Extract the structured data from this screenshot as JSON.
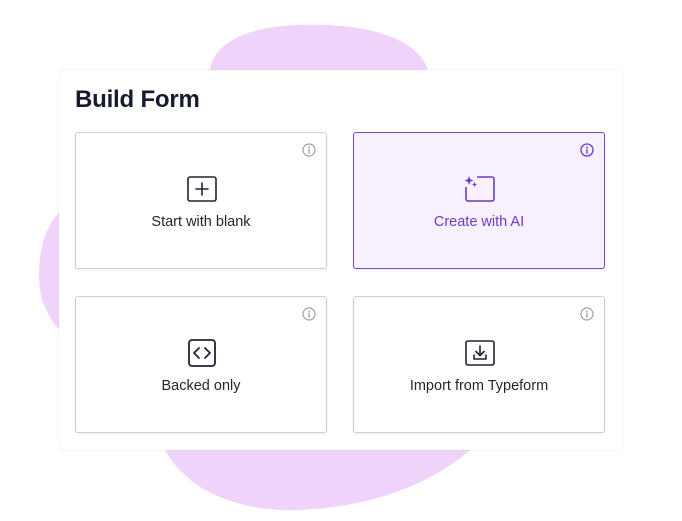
{
  "colors": {
    "blob": "#efd3fb",
    "accent": "#7c44d6",
    "selected_bg": "#f6f0ff",
    "text": "#1f2433"
  },
  "page": {
    "title": "Build Form"
  },
  "options": [
    {
      "label": "Start with blank",
      "icon": "plus-square-icon",
      "selected": false
    },
    {
      "label": "Create with AI",
      "icon": "sparkle-window-icon",
      "selected": true
    },
    {
      "label": "Backed only",
      "icon": "code-brackets-icon",
      "selected": false
    },
    {
      "label": "Import from Typeform",
      "icon": "download-tray-icon",
      "selected": false
    }
  ]
}
